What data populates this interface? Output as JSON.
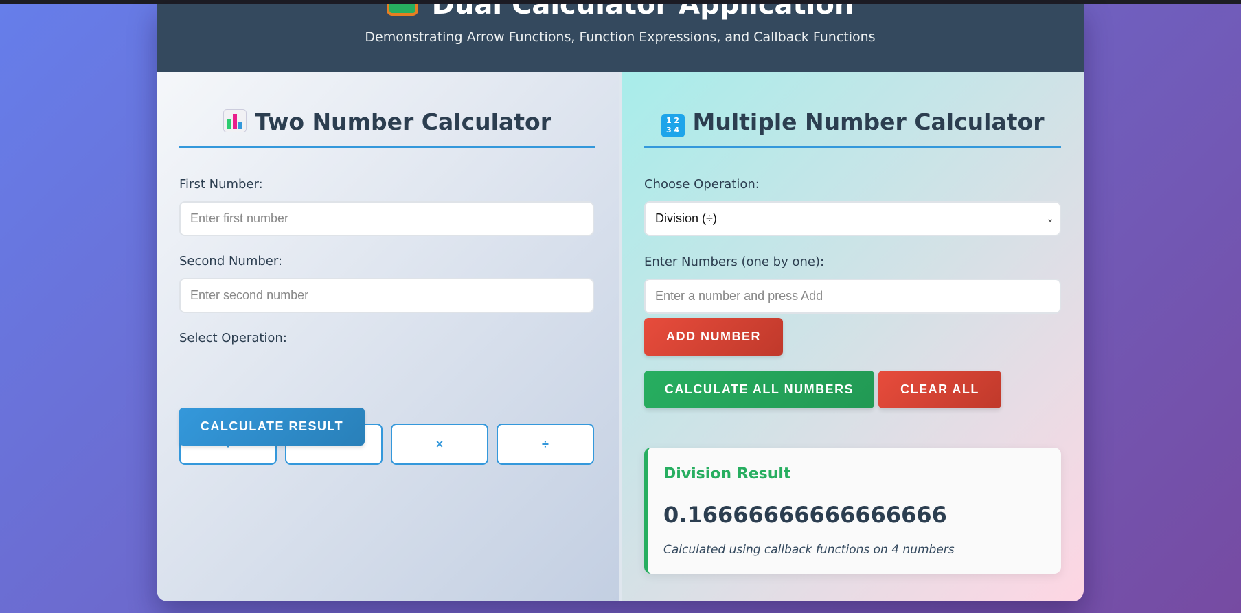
{
  "header": {
    "title": "Dual Calculator Application",
    "subtitle": "Demonstrating Arrow Functions, Function Expressions, and Callback Functions"
  },
  "two_number": {
    "title": "Two Number Calculator",
    "first_label": "First Number:",
    "first_placeholder": "Enter first number",
    "second_label": "Second Number:",
    "second_placeholder": "Enter second number",
    "operation_label": "Select Operation:",
    "operations": [
      "+",
      "-",
      "×",
      "÷"
    ],
    "calculate_label": "Calculate Result"
  },
  "multi_number": {
    "title": "Multiple Number Calculator",
    "operation_label": "Choose Operation:",
    "selected_operation": "Division (÷)",
    "numbers_label": "Enter Numbers (one by one):",
    "number_placeholder": "Enter a number and press Add",
    "add_label": "Add Number",
    "calculate_all_label": "Calculate All Numbers",
    "clear_label": "Clear All",
    "result": {
      "title": "Division Result",
      "value": "0.16666666666666666",
      "note": "Calculated using callback functions on 4 numbers"
    }
  },
  "colors": {
    "accent_blue": "#3498db",
    "success_green": "#27ae60",
    "danger_red": "#e74c3c",
    "header_bg": "#34495e"
  },
  "icons": {
    "title_icon": "calculator-icon",
    "two_number_icon": "bar-chart-icon",
    "multi_number_icon": "input-numbers-icon"
  }
}
